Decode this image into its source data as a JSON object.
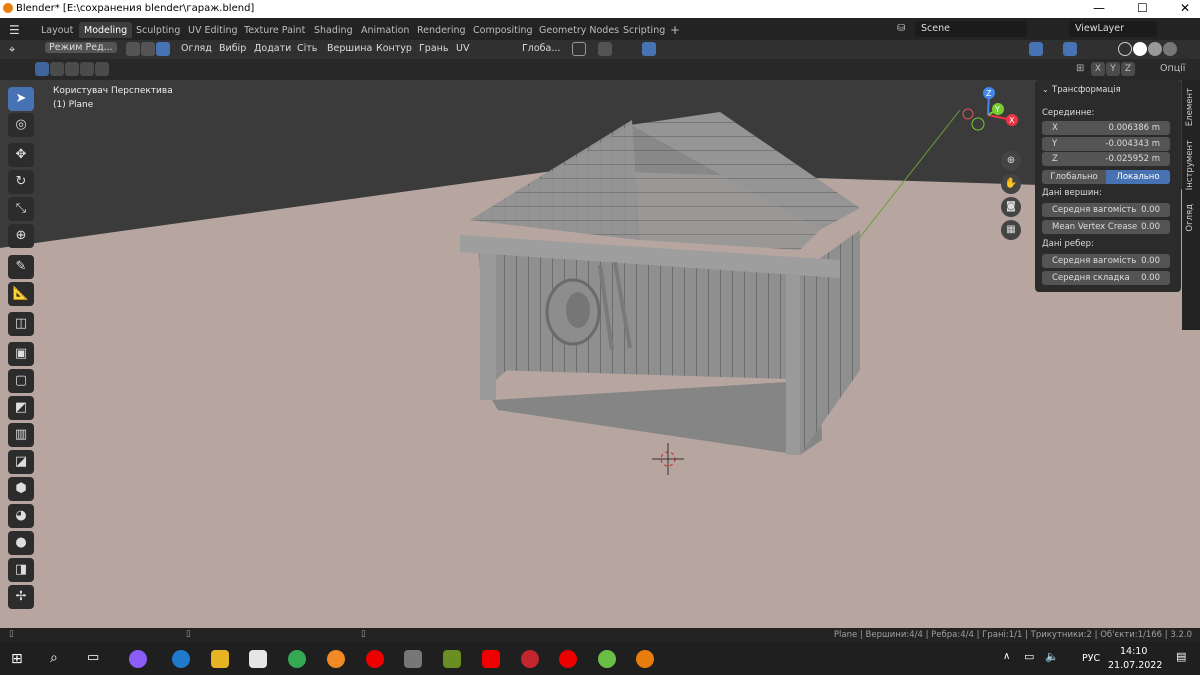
{
  "window": {
    "title": "Blender* [E:\\сохранения blender\\гараж.blend]",
    "min": "—",
    "max": "☐",
    "close": "✕"
  },
  "workspaces": [
    "Layout",
    "Modeling",
    "Sculpting",
    "UV Editing",
    "Texture Paint",
    "Shading",
    "Animation",
    "Rendering",
    "Compositing",
    "Geometry Nodes",
    "Scripting"
  ],
  "active_workspace": "Modeling",
  "add_workspace": "+",
  "scene": "Scene",
  "view_layer": "ViewLayer",
  "header": {
    "mode": "Режим Ред...",
    "menus": [
      "Огляд",
      "Вибір",
      "Додати",
      "Сіть",
      "Вершина",
      "Контур",
      "Грань",
      "UV"
    ],
    "orientation": "Глоба...",
    "options": "Опції"
  },
  "axis_toggles": [
    "X",
    "Y",
    "Z"
  ],
  "viewport": {
    "view_name": "Користувач Перспектива",
    "object": "(1) Plane"
  },
  "gizmo": {
    "x": "X",
    "y": "Y",
    "z": "Z"
  },
  "npanel": {
    "section": "Трансформація",
    "median_label": "Серединне:",
    "x_label": "X",
    "x": "0.006386 m",
    "y_label": "Y",
    "y": "-0.004343 m",
    "z_label": "Z",
    "z": "-0.025952 m",
    "global": "Глобально",
    "local": "Локально",
    "vertex_data": "Дані вершин:",
    "v_mean_weight": "Середня вагомість",
    "v_mean_weight_val": "0.00",
    "v_crease": "Mean Vertex Crease",
    "v_crease_val": "0.00",
    "edge_data": "Дані ребер:",
    "e_mean_weight": "Середня вагомість",
    "e_mean_weight_val": "0.00",
    "e_crease": "Середня складка",
    "e_crease_val": "0.00"
  },
  "side_tabs": [
    "Елемент",
    "Інструмент",
    "Огляд"
  ],
  "status": "Plane | Вершини:4/4 | Ребра:4/4 | Грані:1/1 | Трикутники:2 | Об'єкти:1/166 | 3.2.0",
  "taskbar": {
    "lang": "РУС",
    "time": "14:10",
    "date": "21.07.2022"
  },
  "colors": {
    "accent": "#4772b3",
    "floor": "#b6a6a0",
    "sky": "#3a3a3a",
    "model": "#8c8c8c"
  }
}
